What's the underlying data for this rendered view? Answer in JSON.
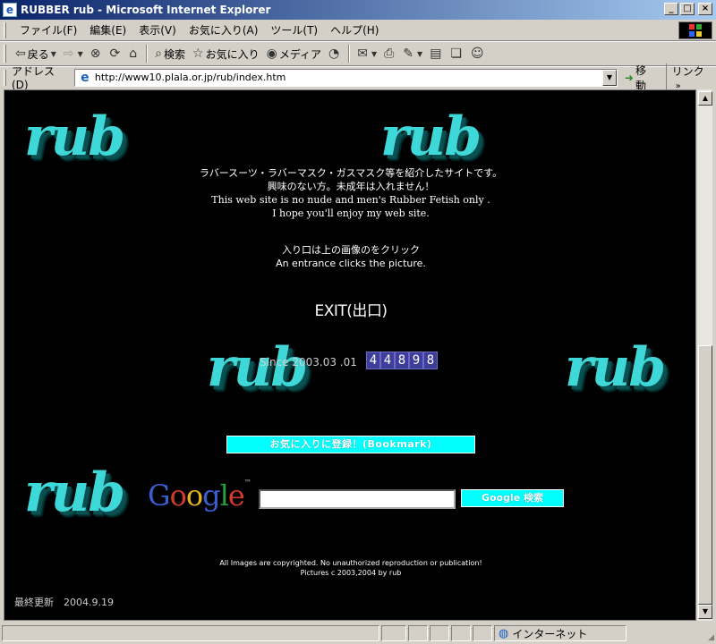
{
  "window": {
    "title": "RUBBER rub - Microsoft Internet Explorer",
    "app_icon": "ie-icon",
    "controls": [
      "minimize",
      "maximize",
      "close"
    ]
  },
  "menubar": {
    "items": [
      "ファイル(F)",
      "編集(E)",
      "表示(V)",
      "お気に入り(A)",
      "ツール(T)",
      "ヘルプ(H)"
    ]
  },
  "toolbar": {
    "back_label": "戻る",
    "search_label": "検索",
    "favorites_label": "お気に入り",
    "media_label": "メディア"
  },
  "address": {
    "label": "アドレス(D)",
    "url": "http://www10.plala.or.jp/rub/index.htm",
    "go_label": "移動",
    "links_label": "リンク"
  },
  "page": {
    "logo_text": "rub",
    "intro_lines": [
      "ラバースーツ・ラバーマスク・ガスマスク等を紹介したサイトです。",
      "興味のない方。未成年は入れません！",
      "This web site is no nude and men's Rubber Fetish only .",
      "I hope you'll enjoy my web site."
    ],
    "entrance_jp": "入り口は上の画像のをクリック",
    "entrance_en": "An entrance clicks the picture.",
    "exit_label": "EXIT(出口)",
    "since_label": "Since 2003.03 .01",
    "counter_digits": [
      "4",
      "4",
      "8",
      "9",
      "8"
    ],
    "bookmark_label": "お気に入りに登録！(Bookmark)",
    "google_search_value": "",
    "google_search_button": "Google 検索",
    "copyright_line1": "All Images are copyrighted. No unauthorized reproduction or publication!",
    "copyright_line2": "Pictures c 2003,2004 by rub",
    "last_updated": "最終更新　2004.9.19"
  },
  "statusbar": {
    "zone_label": "インターネット"
  },
  "colors": {
    "logo_cyan": "#3ed8d8",
    "button_cyan": "#00ffff",
    "counter_bg": "#3e3e9a",
    "page_bg": "#000000"
  }
}
